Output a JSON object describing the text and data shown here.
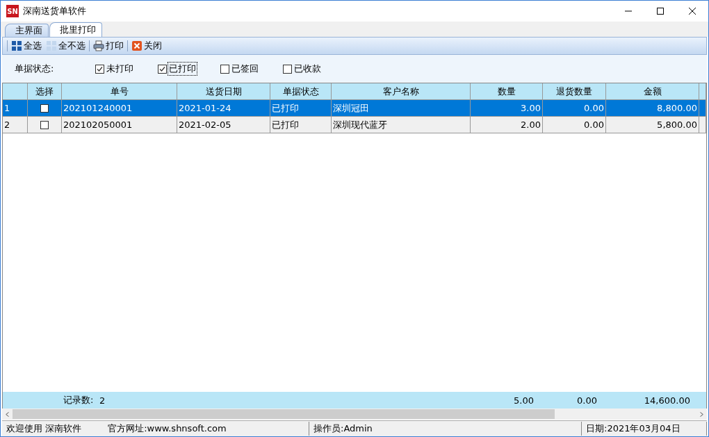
{
  "window": {
    "logo": "SN",
    "title": "深南送货单软件"
  },
  "tabs": [
    {
      "label": "主界面",
      "selected": false
    },
    {
      "label": "批里打印",
      "selected": true
    }
  ],
  "toolbar": [
    {
      "kind": "select-all",
      "label": "全选"
    },
    {
      "kind": "select-none",
      "label": "全不选"
    },
    {
      "kind": "print",
      "label": "打印"
    },
    {
      "kind": "close",
      "label": "关闭"
    }
  ],
  "filter": {
    "label": "单据状态:",
    "options": [
      {
        "label": "未打印",
        "checked": true,
        "focused": false
      },
      {
        "label": "已打印",
        "checked": true,
        "focused": true
      },
      {
        "label": "已签回",
        "checked": false,
        "focused": false
      },
      {
        "label": "已收款",
        "checked": false,
        "focused": false
      }
    ]
  },
  "table": {
    "select_column": "选择",
    "columns": [
      "单号",
      "送货日期",
      "单据状态",
      "客户名称",
      "数量",
      "退货数量",
      "金额"
    ],
    "rows": [
      {
        "number": "1",
        "selected": true,
        "checked": false,
        "cells": [
          "202101240001",
          "2021-01-24",
          "已打印",
          "深圳冠田",
          "3.00",
          "0.00",
          "8,800.00"
        ]
      },
      {
        "number": "2",
        "selected": false,
        "checked": false,
        "cells": [
          "202102050001",
          "2021-02-05",
          "已打印",
          "深圳现代蓝牙",
          "2.00",
          "0.00",
          "5,800.00"
        ]
      }
    ],
    "footer": {
      "count_label": "记录数:",
      "count": "2",
      "quantity": "5.00",
      "returned": "0.00",
      "amount": "14,600.00"
    }
  },
  "status_bar": {
    "welcome": "欢迎使用 深南软件",
    "website": "官方网址:www.shnsoft.com",
    "operator": "操作员:Admin",
    "date": "日期:2021年03月04日"
  }
}
